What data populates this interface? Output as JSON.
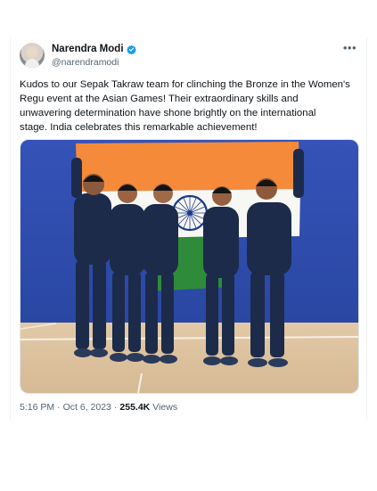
{
  "tweet": {
    "author_name": "Narendra Modi",
    "author_handle": "@narendramodi",
    "more_icon": "more-icon",
    "text": "Kudos to our Sepak Takraw team for clinching the Bronze in the Women's\nRegu event at the Asian Games! Their extraordinary skills and\nunwavering determination have shone brightly on the international\nstage. India celebrates this remarkable achievement!",
    "time": "5:16 PM",
    "date": "Oct 6, 2023",
    "separator": "·",
    "views_count": "255.4K",
    "views_label": "Views"
  },
  "colors": {
    "verified": "#1d9bf0",
    "secondary_text": "#536471",
    "wall_blue": "#2f4fb0",
    "flag_saffron": "#f58a3a",
    "flag_green": "#2e8b3a",
    "uniform_navy": "#1c2b4a"
  }
}
